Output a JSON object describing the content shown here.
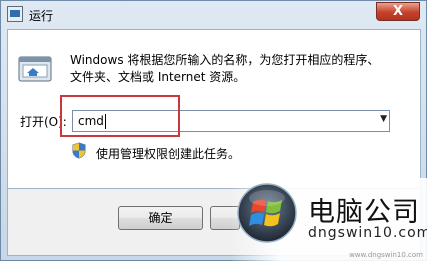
{
  "window": {
    "title": "运行",
    "close_label": "X"
  },
  "description": {
    "line1": "Windows 将根据您所输入的名称，为您打开相应的程序、",
    "line2": "文件夹、文档或 Internet 资源。"
  },
  "open_field": {
    "label": "打开(O):",
    "value": "cmd"
  },
  "admin_note": "使用管理权限创建此任务。",
  "buttons": {
    "ok": "确定"
  },
  "watermark": {
    "title": "电脑公司",
    "url": "dngswin10.com",
    "small": "www.dngswin10.com"
  }
}
